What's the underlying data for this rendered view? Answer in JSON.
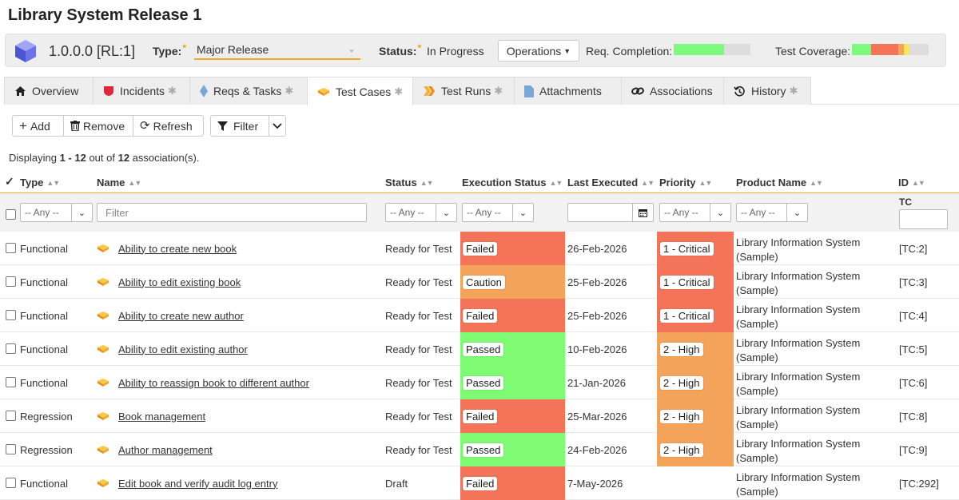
{
  "page": {
    "title": "Library System Release 1"
  },
  "release": {
    "version": "1.0.0.0 [RL:1]",
    "type_label": "Type:",
    "type_value": "Major Release",
    "status_label": "Status:",
    "status_value": "In Progress",
    "operations_label": "Operations",
    "req_completion_label": "Req. Completion:",
    "req_completion": [
      {
        "fraction": 0.66,
        "color": "#7ef97e"
      },
      {
        "fraction": 0.34,
        "color": "#dddddd"
      }
    ],
    "test_coverage_label": "Test Coverage:",
    "test_coverage": [
      {
        "fraction": 0.25,
        "color": "#7ef97e"
      },
      {
        "fraction": 0.35,
        "color": "#f4745a"
      },
      {
        "fraction": 0.08,
        "color": "#f4a35a"
      },
      {
        "fraction": 0.07,
        "color": "#f7e75a"
      },
      {
        "fraction": 0.25,
        "color": "#dddddd"
      }
    ]
  },
  "tabs": [
    {
      "label": "Overview",
      "icon": "home-icon",
      "star": false
    },
    {
      "label": "Incidents",
      "icon": "incident-shield-icon",
      "star": true
    },
    {
      "label": "Reqs & Tasks",
      "icon": "diamond-icon",
      "star": true
    },
    {
      "label": "Test Cases",
      "icon": "test-case-icon",
      "star": true,
      "active": true
    },
    {
      "label": "Test Runs",
      "icon": "test-run-chevrons-icon",
      "star": true
    },
    {
      "label": "Attachments",
      "icon": "document-icon",
      "star": false
    },
    {
      "label": "Associations",
      "icon": "link-icon",
      "star": false
    },
    {
      "label": "History",
      "icon": "history-icon",
      "star": true
    }
  ],
  "toolbar": {
    "add": "Add",
    "remove": "Remove",
    "refresh": "Refresh",
    "filter": "Filter"
  },
  "display": {
    "prefix": "Displaying ",
    "range": "1 - 12",
    "mid": " out of ",
    "total": "12",
    "suffix": " association(s)."
  },
  "columns": {
    "type": "Type",
    "name": "Name",
    "status": "Status",
    "exec_status": "Execution Status",
    "last_executed": "Last Executed",
    "priority": "Priority",
    "product": "Product Name",
    "id": "ID"
  },
  "filters": {
    "any": "-- Any --",
    "name_placeholder": "Filter",
    "id_prefix": "TC"
  },
  "colors": {
    "failed": "#f4745a",
    "caution": "#f4a35a",
    "passed": "#7efb73",
    "critical": "#f4745a",
    "high": "#f4a35a",
    "accent": "#f5a623"
  },
  "rows": [
    {
      "type": "Functional",
      "name": "Ability to create new book",
      "status": "Ready for Test",
      "exec": "Failed",
      "exec_color": "#f4745a",
      "date": "26-Feb-2026",
      "priority": "1 - Critical",
      "priority_color": "#f4745a",
      "product_1": "Library Information System",
      "product_2": "(Sample)",
      "id": "[TC:2]"
    },
    {
      "type": "Functional",
      "name": "Ability to edit existing book",
      "status": "Ready for Test",
      "exec": "Caution",
      "exec_color": "#f4a35a",
      "date": "25-Feb-2026",
      "priority": "1 - Critical",
      "priority_color": "#f4745a",
      "product_1": "Library Information System",
      "product_2": "(Sample)",
      "id": "[TC:3]"
    },
    {
      "type": "Functional",
      "name": "Ability to create new author",
      "status": "Ready for Test",
      "exec": "Failed",
      "exec_color": "#f4745a",
      "date": "25-Feb-2026",
      "priority": "1 - Critical",
      "priority_color": "#f4745a",
      "product_1": "Library Information System",
      "product_2": "(Sample)",
      "id": "[TC:4]"
    },
    {
      "type": "Functional",
      "name": "Ability to edit existing author",
      "status": "Ready for Test",
      "exec": "Passed",
      "exec_color": "#7efb73",
      "date": "10-Feb-2026",
      "priority": "2 - High",
      "priority_color": "#f4a35a",
      "product_1": "Library Information System",
      "product_2": "(Sample)",
      "id": "[TC:5]"
    },
    {
      "type": "Functional",
      "name": "Ability to reassign book to different author",
      "status": "Ready for Test",
      "exec": "Passed",
      "exec_color": "#7efb73",
      "date": "21-Jan-2026",
      "priority": "2 - High",
      "priority_color": "#f4a35a",
      "product_1": "Library Information System",
      "product_2": "(Sample)",
      "id": "[TC:6]"
    },
    {
      "type": "Regression",
      "name": "Book management",
      "status": "Ready for Test",
      "exec": "Failed",
      "exec_color": "#f4745a",
      "date": "25-Mar-2026",
      "priority": "2 - High",
      "priority_color": "#f4a35a",
      "product_1": "Library Information System",
      "product_2": "(Sample)",
      "id": "[TC:8]"
    },
    {
      "type": "Regression",
      "name": "Author management",
      "status": "Ready for Test",
      "exec": "Passed",
      "exec_color": "#7efb73",
      "date": "24-Feb-2026",
      "priority": "2 - High",
      "priority_color": "#f4a35a",
      "product_1": "Library Information System",
      "product_2": "(Sample)",
      "id": "[TC:9]"
    },
    {
      "type": "Functional",
      "name": "Edit book and verify audit log entry",
      "status": "Draft",
      "exec": "Failed",
      "exec_color": "#f4745a",
      "date": "7-May-2026",
      "priority": "",
      "priority_color": "",
      "product_1": "Library Information System",
      "product_2": "(Sample)",
      "id": "[TC:292]"
    }
  ]
}
